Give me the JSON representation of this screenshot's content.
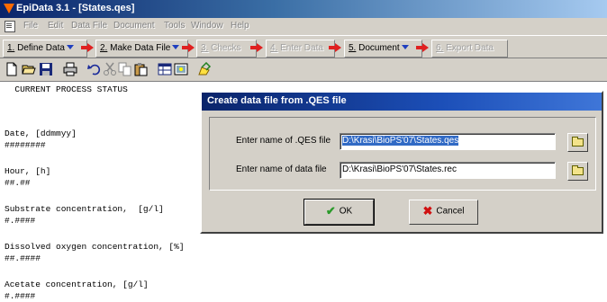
{
  "window": {
    "title": "EpiData 3.1 - [States.qes]"
  },
  "menu": [
    "File",
    "Edit",
    "Data File",
    "Document",
    "Tools",
    "Window",
    "Help"
  ],
  "process_toolbar": [
    {
      "num": "1.",
      "label": " Define Data",
      "dropdown": true,
      "enabled": true
    },
    {
      "num": "2.",
      "label": " Make Data File",
      "dropdown": true,
      "enabled": true
    },
    {
      "num": "3.",
      "label": " Checks",
      "dropdown": false,
      "enabled": false
    },
    {
      "num": "4.",
      "label": " Enter Data",
      "dropdown": false,
      "enabled": false
    },
    {
      "num": "5.",
      "label": " Document",
      "dropdown": true,
      "enabled": true
    },
    {
      "num": "6.",
      "label": " Export Data",
      "dropdown": false,
      "enabled": false
    }
  ],
  "toolbar_icons": [
    "new-file-icon",
    "open-folder-icon",
    "save-icon",
    "print-icon",
    "undo-icon",
    "cut-icon",
    "copy-icon",
    "paste-icon",
    "grid-icon",
    "preview-icon",
    "edit-icon"
  ],
  "editor": {
    "lines": [
      "  CURRENT PROCESS STATUS",
      "",
      "",
      "Date, [ddmmyy]",
      "########",
      "",
      "Hour, [h]",
      "##.##",
      "",
      "Substrate concentration,  [g/l]",
      "#.####",
      "",
      "Dissolved oxygen concentration, [%]",
      "##.####",
      "",
      "Acetate concentration, [g/l]",
      "#.####"
    ]
  },
  "dialog": {
    "title": "Create data file from .QES file",
    "qes_label": "Enter name of .QES file",
    "qes_value": "D:\\Krasi\\BioPS'07\\States.qes",
    "data_label": "Enter name of data file",
    "data_value": "D:\\Krasi\\BioPS'07\\States.rec",
    "ok_label": "OK",
    "cancel_label": "Cancel"
  },
  "colors": {
    "titlebar": "#0a246a",
    "selection": "#316ac5",
    "arrow_red": "#e02020",
    "ok_green": "#2a9a2a",
    "cancel_red": "#d01010"
  }
}
